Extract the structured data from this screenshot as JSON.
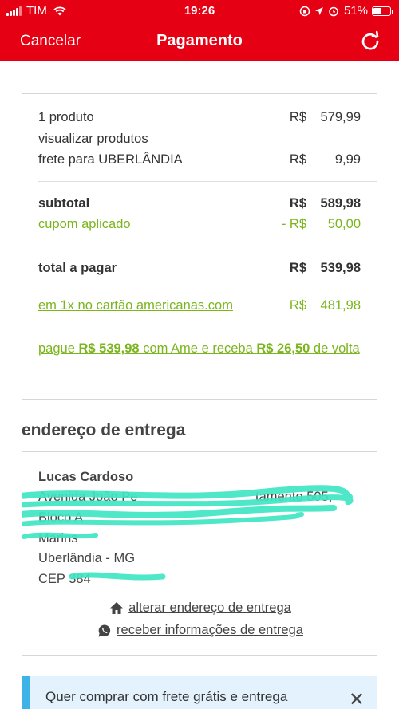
{
  "status": {
    "carrier": "TIM",
    "time": "19:26",
    "battery": "51%",
    "battery_level": 0.51
  },
  "header": {
    "cancel": "Cancelar",
    "title": "Pagamento"
  },
  "summary": {
    "products": "1 produto",
    "products_currency": "R$",
    "products_amount": "579,99",
    "view_products": "visualizar produtos",
    "shipping_label": "frete para UBERLÂNDIA",
    "shipping_currency": "R$",
    "shipping_amount": "9,99",
    "subtotal_label": "subtotal",
    "subtotal_currency": "R$",
    "subtotal_amount": "589,98",
    "coupon_label": "cupom aplicado",
    "coupon_currency": "- R$",
    "coupon_amount": "50,00",
    "total_label": "total a pagar",
    "total_currency": "R$",
    "total_amount": "539,98",
    "card_offer": "em 1x no cartão americanas.com",
    "card_currency": "R$",
    "card_amount": "481,98",
    "ame_1": "pague ",
    "ame_2": "R$ 539,98",
    "ame_3": " com Ame e receba ",
    "ame_4": "R$ 26,50",
    "ame_5": " de volta"
  },
  "delivery": {
    "section_title": "endereço de entrega",
    "name": "Lucas Cardoso",
    "line1": "Avenida João Pe",
    "line1_end": "tamento 505,",
    "line2": "Bloco A",
    "line3": "Marins",
    "city": "Uberlândia - MG",
    "cep": "CEP 384",
    "change_address": "alterar endereço de entrega",
    "receive_info": "receber informações de entrega"
  },
  "promo": {
    "text": "Quer comprar com frete grátis e entrega",
    "close": "✕"
  }
}
